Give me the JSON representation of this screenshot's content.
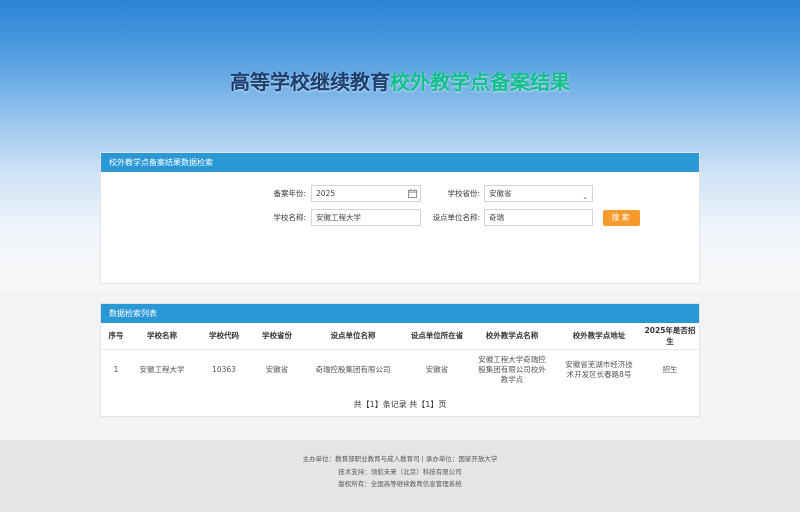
{
  "site": {
    "title_part1": "高等学校继续教育",
    "title_part2": "校外教学点备案结果"
  },
  "search_panel": {
    "title": "校外教学点备案结果数据检索",
    "year_label": "备案年份:",
    "year_value": "2025",
    "province_label": "学校省份:",
    "province_value": "安徽省",
    "school_label": "学校名称:",
    "school_value": "安徽工程大学",
    "unit_label": "设点单位名称:",
    "unit_value": "奇瑞",
    "search_button": "搜索"
  },
  "results_panel": {
    "title": "数据检索列表",
    "columns": [
      "序号",
      "学校名称",
      "学校代码",
      "学校省份",
      "设点单位名称",
      "设点单位所在省",
      "校外教学点名称",
      "校外教学点地址",
      "2025年是否招生"
    ],
    "rows": [
      [
        "1",
        "安徽工程大学",
        "10363",
        "安徽省",
        "奇瑞控股集团有限公司",
        "安徽省",
        "安徽工程大学奇瑞控股集团有限公司校外教学点",
        "安徽省芜湖市经济技术开发区长春路8号",
        "招生"
      ]
    ],
    "pager": "共【1】条记录 共【1】页"
  },
  "footer": {
    "line1": "主办单位：教育部职业教育与成人教育司 | 承办单位：国家开放大学",
    "line2": "技术支持：领航未来（北京）科技有限公司",
    "line3": "版权所有：全国高等继续教育信息管理系统"
  },
  "colors": {
    "header_blue": "#2b98d6",
    "title_dark": "#1d3f6e",
    "title_green": "#13c08b",
    "button_orange": "#f79a2e"
  }
}
